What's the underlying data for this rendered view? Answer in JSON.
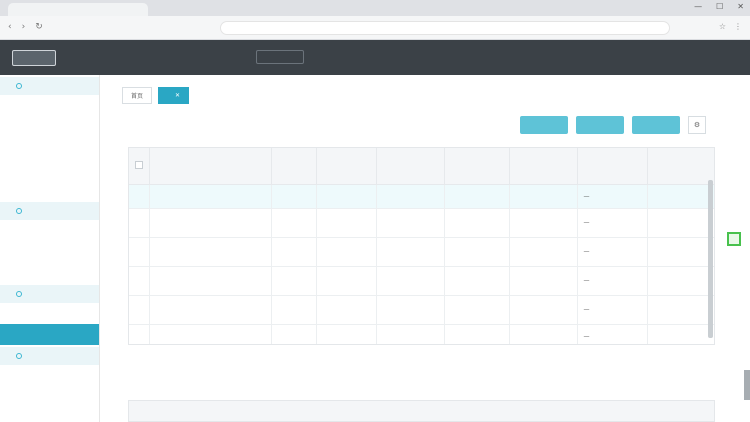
{
  "browser": {
    "tab_title": "",
    "url": "",
    "controls": [
      "—",
      "☐",
      "✕"
    ]
  },
  "header": {
    "menu": [
      "",
      "",
      ""
    ],
    "user": ""
  },
  "sidebar": {
    "groups": [
      {
        "label": "",
        "items": [
          "",
          "",
          "",
          "",
          ""
        ]
      },
      {
        "label": "",
        "items": [
          "",
          "",
          ""
        ]
      },
      {
        "label": "",
        "items": [
          "",
          ""
        ],
        "active_index": 1
      },
      {
        "label": "",
        "items": [
          "",
          ""
        ]
      }
    ]
  },
  "tabs": [
    {
      "label": "首页"
    },
    {
      "label": "",
      "active": true
    }
  ],
  "toolbar": {
    "buttons": [
      "",
      "",
      ""
    ]
  },
  "table": {
    "headers": [
      "",
      "",
      "",
      "",
      "",
      "",
      "",
      ""
    ],
    "rows": [
      [
        "",
        "",
        "",
        "",
        "",
        "",
        "—",
        ""
      ],
      [
        "",
        "",
        "",
        "",
        "",
        "",
        "—",
        ""
      ],
      [
        "",
        "",
        "",
        "",
        "",
        "",
        "—",
        ""
      ],
      [
        "",
        "",
        "",
        "",
        "",
        "",
        "—",
        ""
      ],
      [
        "",
        "",
        "",
        "",
        "",
        "",
        "—",
        ""
      ],
      [
        "",
        "",
        "",
        "",
        "",
        "",
        "—",
        ""
      ],
      [
        "",
        "",
        "",
        "",
        "",
        "",
        "—",
        ""
      ]
    ]
  },
  "section": {
    "label": ""
  },
  "colors": {
    "accent": "#2aa7c4",
    "header_bg": "#3b4147",
    "orange": "#f0a13a"
  }
}
